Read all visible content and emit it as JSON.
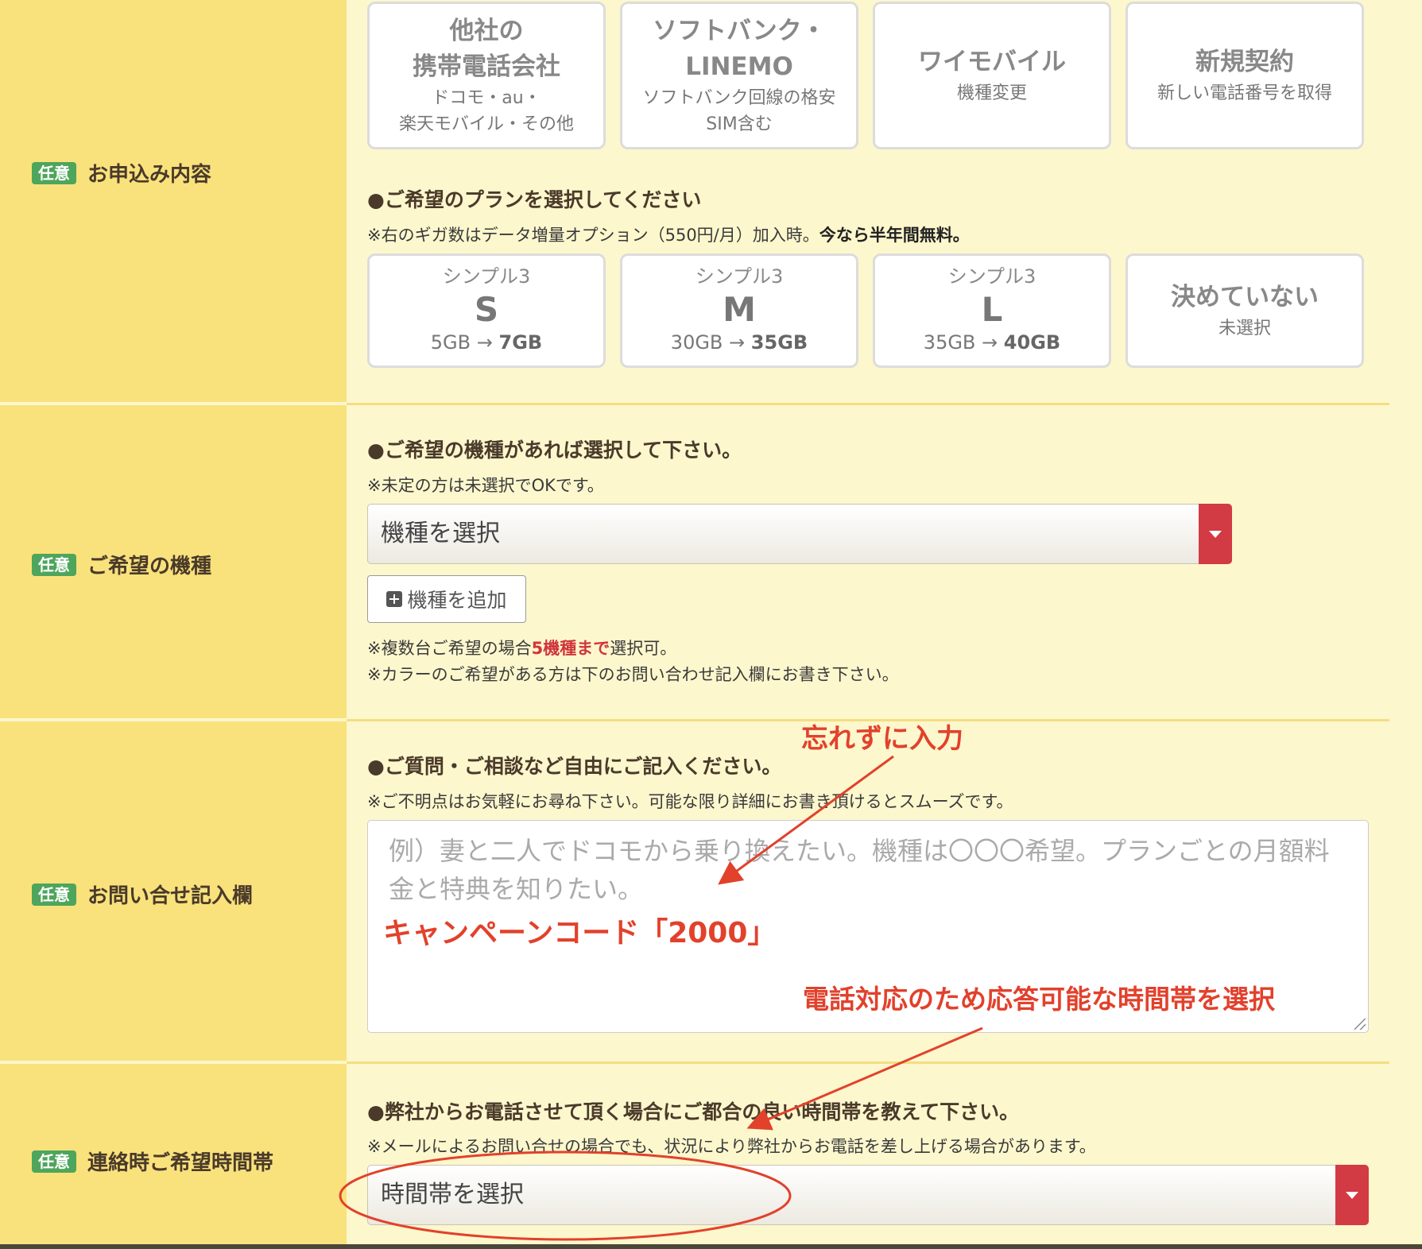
{
  "rows": {
    "contract": {
      "badge": "任意",
      "title": "お申込み内容"
    },
    "device": {
      "badge": "任意",
      "title": "ご希望の機種"
    },
    "inquiry": {
      "badge": "任意",
      "title": "お問い合せ記入欄"
    },
    "time": {
      "badge": "任意",
      "title": "連絡時ご希望時間帯"
    }
  },
  "carriers": [
    {
      "line1": "他社の",
      "line2": "携帯電話会社",
      "sub1": "ドコモ・au・",
      "sub2": "楽天モバイル・その他"
    },
    {
      "line1": "ソフトバンク・",
      "line2": "LINEMO",
      "sub1": "ソフトバンク回線の格安",
      "sub2": "SIM含む"
    },
    {
      "line1": "ワイモバイル",
      "sub1": "機種変更"
    },
    {
      "line1": "新規契約",
      "sub1": "新しい電話番号を取得"
    }
  ],
  "plan_section": {
    "heading": "●ご希望のプランを選択してください",
    "note": "※右のギガ数はデータ増量オプション（550円/月）加入時。",
    "note_bold": "今なら半年間無料。"
  },
  "plans": [
    {
      "name": "シンプル3",
      "size": "S",
      "from": "5GB",
      "arrow": "→",
      "to": "7GB"
    },
    {
      "name": "シンプル3",
      "size": "M",
      "from": "30GB",
      "arrow": "→",
      "to": "35GB"
    },
    {
      "name": "シンプル3",
      "size": "L",
      "from": "35GB",
      "arrow": "→",
      "to": "40GB"
    },
    {
      "name": "決めていない",
      "sub": "未選択"
    }
  ],
  "device_section": {
    "heading": "●ご希望の機種があれば選択して下さい。",
    "note": "※未定の方は未選択でOKです。",
    "select_value": "機種を選択",
    "add_button": "機種を追加",
    "note2_a": "※複数台ご希望の場合",
    "note2_red": "5機種まで",
    "note2_b": "選択可。",
    "note3": "※カラーのご希望がある方は下のお問い合わせ記入欄にお書き下さい。"
  },
  "inquiry_section": {
    "heading": "●ご質問・ご相談など自由にご記入ください。",
    "note": "※ご不明点はお気軽にお尋ね下さい。可能な限り詳細にお書き頂けるとスムーズです。",
    "placeholder": "例）妻と二人でドコモから乗り換えたい。機種は〇〇〇希望。プランごとの月額料金と特典を知りたい。"
  },
  "time_section": {
    "heading": "●弊社からお電話させて頂く場合にご都合の良い時間帯を教えて下さい。",
    "note": "※メールによるお問い合せの場合でも、状況により弊社からお電話を差し上げる場合があります。",
    "select_value": "時間帯を選択"
  },
  "annotations": {
    "reminder": "忘れずに入力",
    "campaign_code": "キャンペーンコード「2000」",
    "phone_hint": "電話対応のため応答可能な時間帯を選択"
  },
  "colors": {
    "label_column": "#f9e27c",
    "content_bg": "#fdf7cd",
    "badge_green": "#4ea55c",
    "select_arrow_red": "#d23a44",
    "annotation_red": "#e2412c"
  }
}
